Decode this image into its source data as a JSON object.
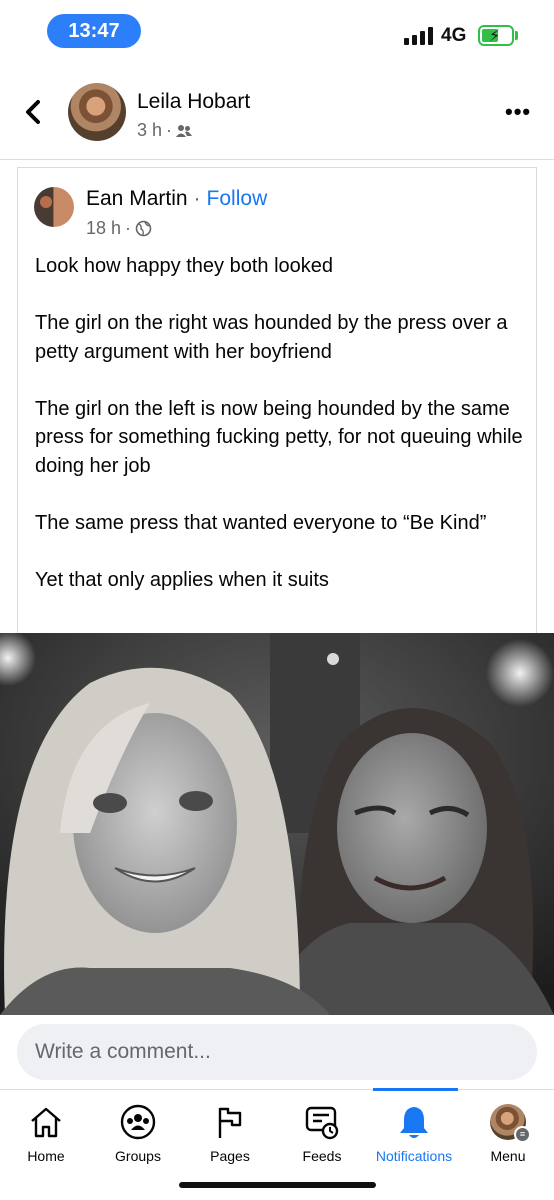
{
  "status_bar": {
    "time": "13:47",
    "network": "4G"
  },
  "header": {
    "author": "Leila Hobart",
    "time": "3 h",
    "separator": "·",
    "audience_icon": "friends-icon",
    "more_icon": "more-options-icon"
  },
  "shared_post": {
    "author": "Ean Martin",
    "separator": "·",
    "follow_label": "Follow",
    "time": "18 h",
    "audience_icon": "globe-icon",
    "paragraphs": [
      "Look how happy they both looked",
      "The girl on the right was hounded by the press over a petty argument with her boyfriend",
      "The girl on the left is now being hounded by the same press for something fucking petty, for not queuing while doing her job",
      "The same press that wanted everyone to “Be Kind”",
      "Yet that only applies when it suits"
    ]
  },
  "comment": {
    "placeholder": "Write a comment..."
  },
  "nav": {
    "items": [
      {
        "label": "Home",
        "icon": "home-icon"
      },
      {
        "label": "Groups",
        "icon": "groups-icon"
      },
      {
        "label": "Pages",
        "icon": "flag-icon"
      },
      {
        "label": "Feeds",
        "icon": "feeds-icon"
      },
      {
        "label": "Notifications",
        "icon": "bell-icon"
      },
      {
        "label": "Menu",
        "icon": "profile-avatar"
      }
    ]
  },
  "colors": {
    "accent": "#1877f2",
    "secondary_text": "#65676b",
    "status_pill": "#2d7ff9",
    "battery": "#30c048"
  }
}
